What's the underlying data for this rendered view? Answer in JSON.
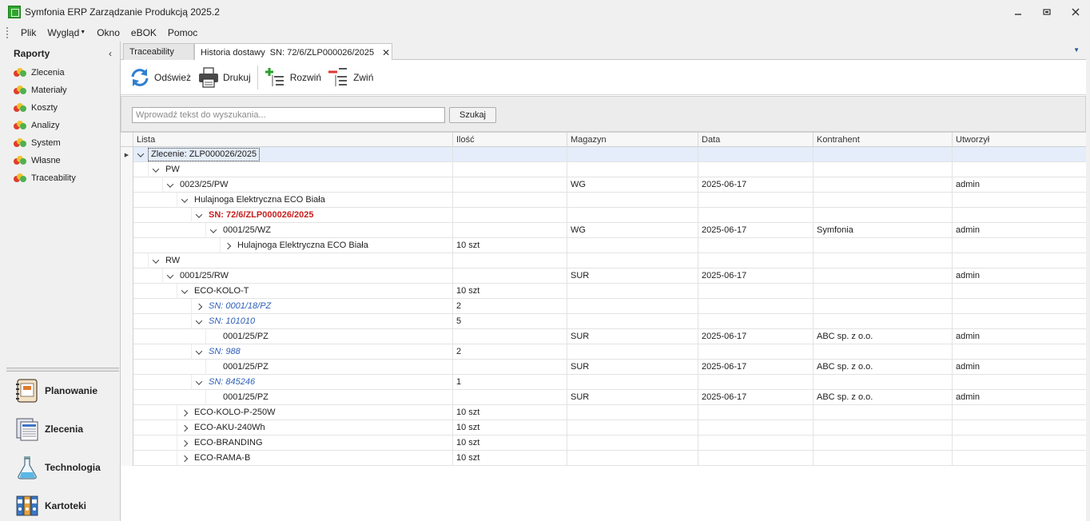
{
  "window": {
    "title": "Symfonia ERP Zarządzanie Produkcją 2025.2",
    "controls": [
      "minimize",
      "restore",
      "close"
    ]
  },
  "menu": {
    "items": [
      {
        "label": "Plik"
      },
      {
        "label": "Wygląd",
        "has_dropdown": true
      },
      {
        "label": "Okno"
      },
      {
        "label": "eBOK"
      },
      {
        "label": "Pomoc"
      }
    ]
  },
  "leftpane": {
    "title": "Raporty",
    "collapse_glyph": "‹",
    "reports": [
      {
        "label": "Zlecenia"
      },
      {
        "label": "Materiały"
      },
      {
        "label": "Koszty"
      },
      {
        "label": "Analizy"
      },
      {
        "label": "System"
      },
      {
        "label": "Własne"
      },
      {
        "label": "Traceability"
      }
    ],
    "modules": [
      {
        "label": "Planowanie",
        "icon": "planner-icon"
      },
      {
        "label": "Zlecenia",
        "icon": "orders-icon"
      },
      {
        "label": "Technologia",
        "icon": "flask-icon"
      },
      {
        "label": "Kartoteki",
        "icon": "binders-icon"
      }
    ]
  },
  "tabs": [
    {
      "label": "Traceability",
      "active": false
    },
    {
      "label": "Historia dostawy  SN: 72/6/ZLP000026/2025",
      "active": true,
      "closable": true
    }
  ],
  "toolbar": {
    "refresh_label": "Odśwież",
    "print_label": "Drukuj",
    "expand_label": "Rozwiń",
    "collapse_label": "Zwiń"
  },
  "search": {
    "placeholder": "Wprowadź tekst do wyszukania...",
    "value": "",
    "button_label": "Szukaj"
  },
  "grid": {
    "columns": [
      "Lista",
      "Ilość",
      "Magazyn",
      "Data",
      "Kontrahent",
      "Utworzył"
    ],
    "rows": [
      {
        "level": 0,
        "toggle": "down",
        "text": "Zlecenie: ZLP000026/2025",
        "style": "focused",
        "selected": true,
        "ilosc": "",
        "magazyn": "",
        "data": "",
        "kontrahent": "",
        "utworzyl": ""
      },
      {
        "level": 1,
        "toggle": "down",
        "text": "PW",
        "style": "",
        "ilosc": "",
        "magazyn": "",
        "data": "",
        "kontrahent": "",
        "utworzyl": ""
      },
      {
        "level": 2,
        "toggle": "down",
        "text": "0023/25/PW",
        "style": "",
        "ilosc": "",
        "magazyn": "WG",
        "data": "2025-06-17",
        "kontrahent": "",
        "utworzyl": "admin"
      },
      {
        "level": 3,
        "toggle": "down",
        "text": "Hulajnoga Elektryczna ECO Biała",
        "style": "",
        "ilosc": "",
        "magazyn": "",
        "data": "",
        "kontrahent": "",
        "utworzyl": ""
      },
      {
        "level": 4,
        "toggle": "down",
        "text": "SN: 72/6/ZLP000026/2025",
        "style": "sn-red",
        "ilosc": "",
        "magazyn": "",
        "data": "",
        "kontrahent": "",
        "utworzyl": ""
      },
      {
        "level": 5,
        "toggle": "down",
        "text": "0001/25/WZ",
        "style": "",
        "ilosc": "",
        "magazyn": "WG",
        "data": "2025-06-17",
        "kontrahent": "Symfonia",
        "utworzyl": "admin"
      },
      {
        "level": 6,
        "toggle": "right",
        "text": "Hulajnoga Elektryczna ECO Biała",
        "style": "",
        "ilosc": "10 szt",
        "magazyn": "",
        "data": "",
        "kontrahent": "",
        "utworzyl": ""
      },
      {
        "level": 1,
        "toggle": "down",
        "text": "RW",
        "style": "",
        "ilosc": "",
        "magazyn": "",
        "data": "",
        "kontrahent": "",
        "utworzyl": ""
      },
      {
        "level": 2,
        "toggle": "down",
        "text": "0001/25/RW",
        "style": "",
        "ilosc": "",
        "magazyn": "SUR",
        "data": "2025-06-17",
        "kontrahent": "",
        "utworzyl": "admin"
      },
      {
        "level": 3,
        "toggle": "down",
        "text": "ECO-KOLO-T",
        "style": "",
        "ilosc": "10 szt",
        "magazyn": "",
        "data": "",
        "kontrahent": "",
        "utworzyl": ""
      },
      {
        "level": 4,
        "toggle": "right",
        "text": "SN: 0001/18/PZ",
        "style": "sn-blue",
        "ilosc": "2",
        "magazyn": "",
        "data": "",
        "kontrahent": "",
        "utworzyl": ""
      },
      {
        "level": 4,
        "toggle": "down",
        "text": "SN: 101010",
        "style": "sn-blue",
        "ilosc": "5",
        "magazyn": "",
        "data": "",
        "kontrahent": "",
        "utworzyl": ""
      },
      {
        "level": 5,
        "toggle": "none",
        "text": "0001/25/PZ",
        "style": "",
        "ilosc": "",
        "magazyn": "SUR",
        "data": "2025-06-17",
        "kontrahent": "ABC sp. z o.o.",
        "utworzyl": "admin"
      },
      {
        "level": 4,
        "toggle": "down",
        "text": "SN: 988",
        "style": "sn-blue",
        "ilosc": "2",
        "magazyn": "",
        "data": "",
        "kontrahent": "",
        "utworzyl": ""
      },
      {
        "level": 5,
        "toggle": "none",
        "text": "0001/25/PZ",
        "style": "",
        "ilosc": "",
        "magazyn": "SUR",
        "data": "2025-06-17",
        "kontrahent": "ABC sp. z o.o.",
        "utworzyl": "admin"
      },
      {
        "level": 4,
        "toggle": "down",
        "text": "SN: 845246",
        "style": "sn-blue",
        "ilosc": "1",
        "magazyn": "",
        "data": "",
        "kontrahent": "",
        "utworzyl": ""
      },
      {
        "level": 5,
        "toggle": "none",
        "text": "0001/25/PZ",
        "style": "",
        "ilosc": "",
        "magazyn": "SUR",
        "data": "2025-06-17",
        "kontrahent": "ABC sp. z o.o.",
        "utworzyl": "admin"
      },
      {
        "level": 3,
        "toggle": "right",
        "text": "ECO-KOLO-P-250W",
        "style": "",
        "ilosc": "10 szt",
        "magazyn": "",
        "data": "",
        "kontrahent": "",
        "utworzyl": ""
      },
      {
        "level": 3,
        "toggle": "right",
        "text": "ECO-AKU-240Wh",
        "style": "",
        "ilosc": "10 szt",
        "magazyn": "",
        "data": "",
        "kontrahent": "",
        "utworzyl": ""
      },
      {
        "level": 3,
        "toggle": "right",
        "text": "ECO-BRANDING",
        "style": "",
        "ilosc": "10 szt",
        "magazyn": "",
        "data": "",
        "kontrahent": "",
        "utworzyl": ""
      },
      {
        "level": 3,
        "toggle": "right",
        "text": "ECO-RAMA-B",
        "style": "",
        "ilosc": "10 szt",
        "magazyn": "",
        "data": "",
        "kontrahent": "",
        "utworzyl": ""
      }
    ]
  },
  "colors": {
    "sn_selected_red": "#c81e1e",
    "sn_blue": "#2f5fb8",
    "selection": "#e4edf9",
    "accent_blue": "#2b5797"
  }
}
